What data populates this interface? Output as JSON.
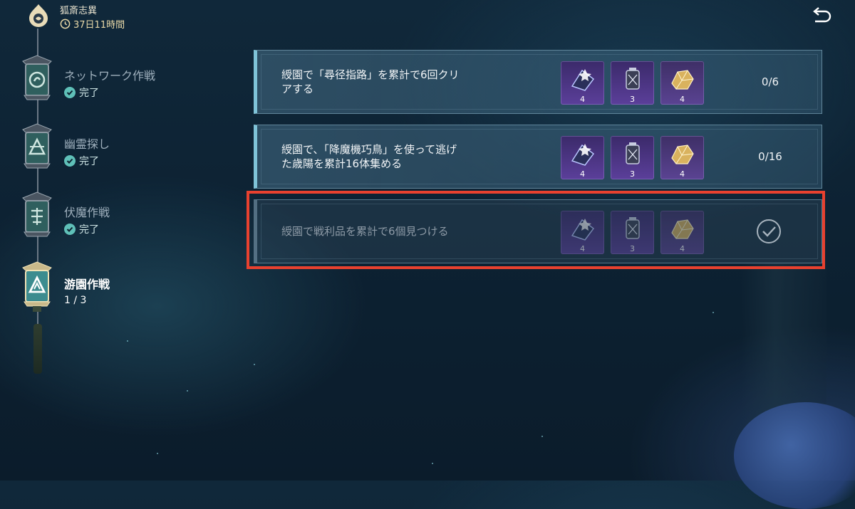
{
  "header": {
    "event_title": "狐斎志異",
    "timer": "37日11時間",
    "logo_icon": "fox-flame-logo-icon",
    "back_icon": "back-arrow-icon"
  },
  "stages": [
    {
      "name": "ネットワーク作戦",
      "status": "完了",
      "completed": true,
      "icon": "lantern-swirl-icon"
    },
    {
      "name": "幽霊探し",
      "status": "完了",
      "completed": true,
      "icon": "lantern-triangle-icon"
    },
    {
      "name": "伏魔作戦",
      "status": "完了",
      "completed": true,
      "icon": "lantern-seal-icon"
    },
    {
      "name": "游園作戦",
      "status": "1 / 3",
      "completed": false,
      "active": true,
      "icon": "lantern-triangle-glow-icon"
    }
  ],
  "missions": [
    {
      "text": "綬園で「尋径指路」を累計で6回クリアする",
      "progress": "0/6",
      "completed": false,
      "rewards": [
        {
          "icon": "purple-crystal-book-icon",
          "qty": "4"
        },
        {
          "icon": "dark-lantern-icon",
          "qty": "3"
        },
        {
          "icon": "gold-ore-icon",
          "qty": "4"
        }
      ]
    },
    {
      "text": "綬園で、「降魔機巧鳥」を使って逃げた歳陽を累計16体集める",
      "progress": "0/16",
      "completed": false,
      "rewards": [
        {
          "icon": "purple-crystal-book-icon",
          "qty": "4"
        },
        {
          "icon": "dark-lantern-icon",
          "qty": "3"
        },
        {
          "icon": "gold-ore-icon",
          "qty": "4"
        }
      ]
    },
    {
      "text": "綬園で戦利品を累計で6個見つける",
      "progress": "",
      "completed": true,
      "rewards": [
        {
          "icon": "purple-crystal-book-icon",
          "qty": "4"
        },
        {
          "icon": "dark-lantern-icon",
          "qty": "3"
        },
        {
          "icon": "gold-ore-icon",
          "qty": "4"
        }
      ]
    }
  ],
  "colors": {
    "highlight": "#e8412f",
    "accent_teal": "#5fc0b8",
    "card_border": "#7fc3d8"
  }
}
